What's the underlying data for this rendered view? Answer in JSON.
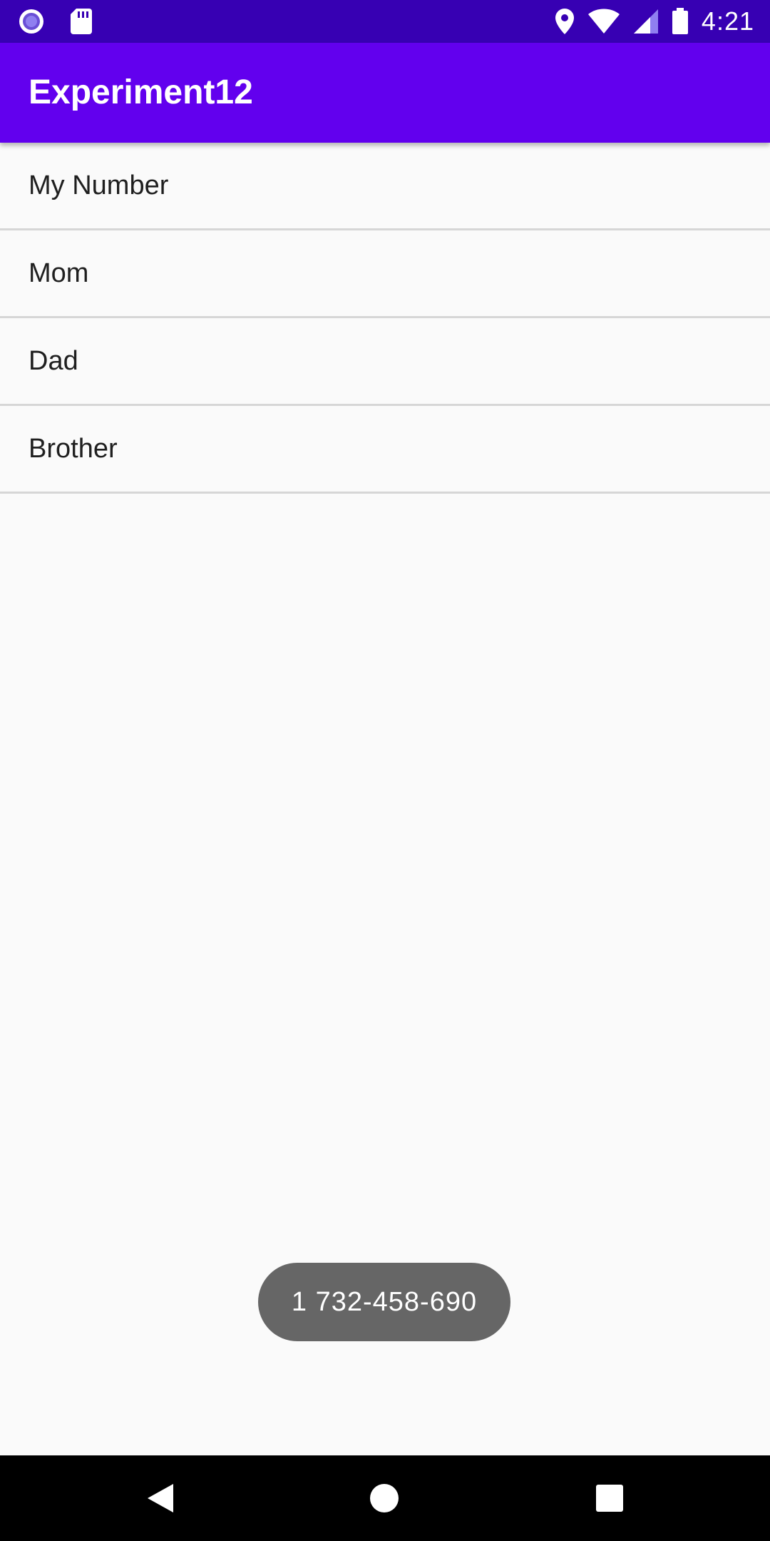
{
  "status_bar": {
    "time": "4:21",
    "left_icons": [
      "record-indicator-icon",
      "sd-card-icon"
    ],
    "right_icons": [
      "location-icon",
      "wifi-icon",
      "cell-signal-icon",
      "battery-icon"
    ]
  },
  "app_bar": {
    "title": "Experiment12"
  },
  "contacts": {
    "items": [
      {
        "label": "My Number"
      },
      {
        "label": "Mom"
      },
      {
        "label": "Dad"
      },
      {
        "label": "Brother"
      }
    ]
  },
  "toast": {
    "text": "1 732-458-690"
  },
  "nav_bar": {
    "buttons": [
      "back-icon",
      "home-icon",
      "recents-icon"
    ]
  },
  "colors": {
    "status_bar": "#3700b3",
    "app_bar": "#6200ee",
    "background": "#fafafa",
    "toast": "#666666",
    "nav_bar": "#000000"
  }
}
